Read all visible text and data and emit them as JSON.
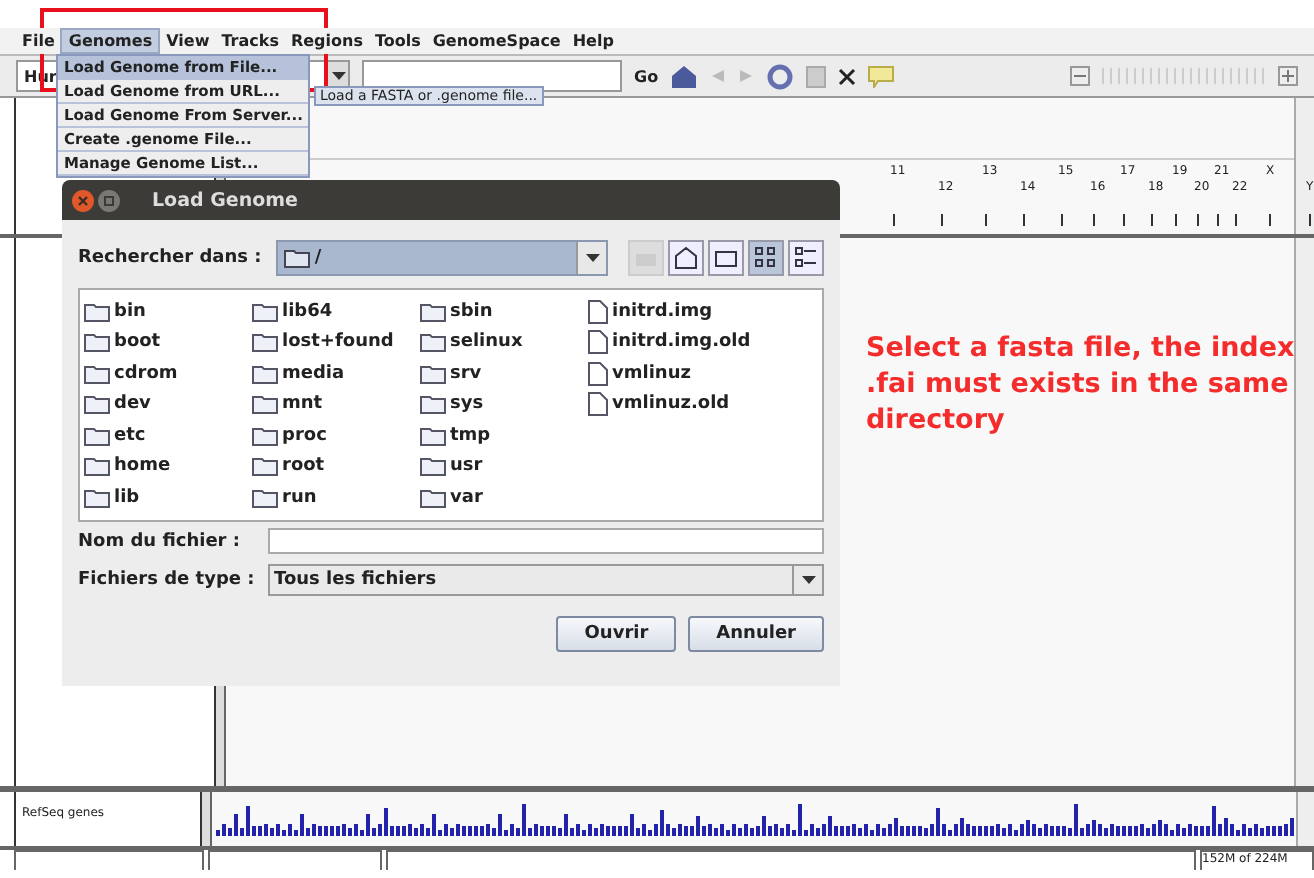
{
  "menubar": [
    {
      "label": "File",
      "selected": false
    },
    {
      "label": "Genomes",
      "selected": true
    },
    {
      "label": "View",
      "selected": false
    },
    {
      "label": "Tracks",
      "selected": false
    },
    {
      "label": "Regions",
      "selected": false
    },
    {
      "label": "Tools",
      "selected": false
    },
    {
      "label": "GenomeSpace",
      "selected": false
    },
    {
      "label": "Help",
      "selected": false
    }
  ],
  "genome_menu": [
    {
      "label": "Load Genome from File...",
      "selected": true
    },
    {
      "label": "Load Genome from URL...",
      "selected": false
    },
    {
      "label": "Load Genome From Server...",
      "selected": false
    },
    {
      "label": "Create .genome File...",
      "selected": false
    },
    {
      "label": "Manage Genome List...",
      "selected": false
    }
  ],
  "tooltip": "Load a FASTA or .genome file...",
  "toolbar": {
    "genome": "Hur",
    "go": "Go"
  },
  "ruler": {
    "labels": [
      "11",
      "12",
      "13",
      "14",
      "15",
      "16",
      "17",
      "18",
      "19",
      "20",
      "21",
      "22",
      "X",
      "Y"
    ]
  },
  "tracks": [
    {
      "name": "RefSeq genes"
    }
  ],
  "status_bar": {
    "memory": "152M of 224M"
  },
  "dialog": {
    "title": "Load Genome",
    "look_in_label": "Rechercher dans :",
    "look_in": "/",
    "view_buttons": [
      {
        "kind": "list",
        "selected": true
      },
      {
        "kind": "details",
        "selected": false
      }
    ],
    "files": [
      {
        "name": "bin",
        "kind": "folder"
      },
      {
        "name": "boot",
        "kind": "folder"
      },
      {
        "name": "cdrom",
        "kind": "folder"
      },
      {
        "name": "dev",
        "kind": "folder"
      },
      {
        "name": "etc",
        "kind": "folder"
      },
      {
        "name": "home",
        "kind": "folder"
      },
      {
        "name": "lib",
        "kind": "folder"
      },
      {
        "name": "lib64",
        "kind": "folder"
      },
      {
        "name": "lost+found",
        "kind": "folder"
      },
      {
        "name": "media",
        "kind": "folder"
      },
      {
        "name": "mnt",
        "kind": "folder"
      },
      {
        "name": "proc",
        "kind": "folder"
      },
      {
        "name": "root",
        "kind": "folder"
      },
      {
        "name": "run",
        "kind": "folder"
      },
      {
        "name": "sbin",
        "kind": "folder"
      },
      {
        "name": "selinux",
        "kind": "folder"
      },
      {
        "name": "srv",
        "kind": "folder"
      },
      {
        "name": "sys",
        "kind": "folder"
      },
      {
        "name": "tmp",
        "kind": "folder"
      },
      {
        "name": "usr",
        "kind": "folder"
      },
      {
        "name": "var",
        "kind": "folder"
      },
      {
        "name": "initrd.img",
        "kind": "file"
      },
      {
        "name": "initrd.img.old",
        "kind": "file"
      },
      {
        "name": "vmlinuz",
        "kind": "file"
      },
      {
        "name": "vmlinuz.old",
        "kind": "file"
      }
    ],
    "filename_label": "Nom du fichier :",
    "filetype_label": "Fichiers de type :",
    "filetype": "Tous les fichiers",
    "buttons": [
      "Ouvrir",
      "Annuler"
    ]
  },
  "annotation": "Select a fasta file, the index .fai must exists in the same directory"
}
